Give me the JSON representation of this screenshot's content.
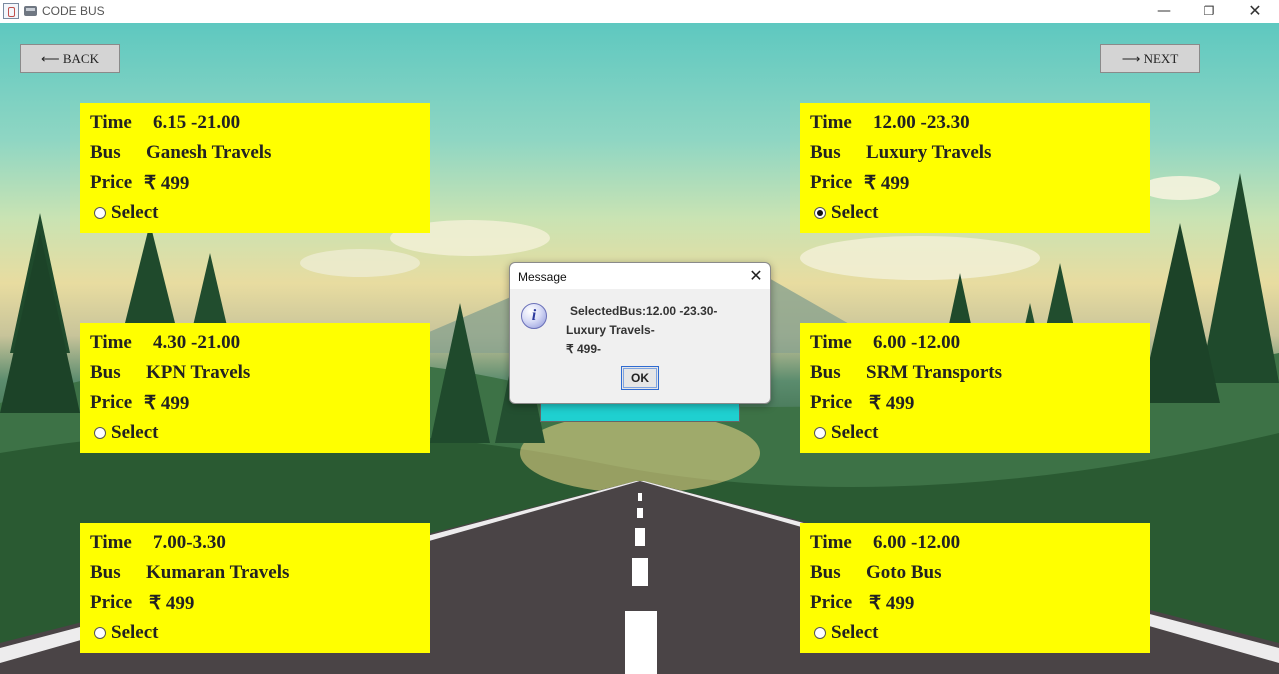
{
  "window": {
    "title": "CODE BUS",
    "controls": {
      "minimize": "—",
      "maximize": "❐",
      "close": "✕"
    }
  },
  "nav": {
    "back_label": "⟵ BACK",
    "next_label": "⟶ NEXT"
  },
  "card_labels": {
    "time": "Time",
    "bus": "Bus",
    "price": "Price",
    "select": "Select"
  },
  "buses": [
    {
      "time": "6.15 -21.00",
      "bus": "Ganesh Travels",
      "price": "₹ 499",
      "selected": false
    },
    {
      "time": "12.00 -23.30",
      "bus": "Luxury Travels",
      "price": "₹ 499",
      "selected": true
    },
    {
      "time": "4.30 -21.00",
      "bus": "KPN Travels",
      "price": "₹ 499",
      "selected": false
    },
    {
      "time": "6.00 -12.00",
      "bus": "SRM Transports",
      "price": "₹ 499",
      "selected": false
    },
    {
      "time": "7.00-3.30",
      "bus": "Kumaran Travels",
      "price": "₹ 499",
      "selected": false
    },
    {
      "time": "6.00 -12.00",
      "bus": "Goto Bus",
      "price": "₹ 499",
      "selected": false
    }
  ],
  "dialog": {
    "title": "Message",
    "line1": "SelectedBus:12.00 -23.30-",
    "line2": "Luxury Travels-",
    "line3": "₹ 499-",
    "ok_label": "OK",
    "icon": "info-icon"
  },
  "colors": {
    "card_bg": "#ffff00",
    "center_button": "#1fd0d0"
  }
}
